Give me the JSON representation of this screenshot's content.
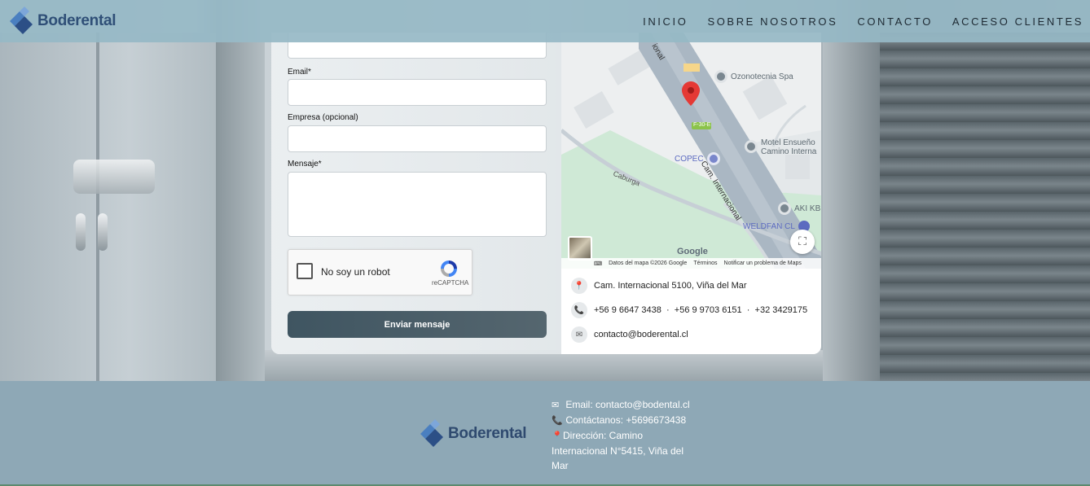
{
  "brand": {
    "name": "Boderental"
  },
  "nav": {
    "items": [
      {
        "label": "INICIO"
      },
      {
        "label": "SOBRE NOSOTROS"
      },
      {
        "label": "CONTACTO"
      },
      {
        "label": "ACCESO CLIENTES"
      }
    ]
  },
  "form": {
    "email_label": "Email*",
    "company_label": "Empresa (opcional)",
    "message_label": "Mensaje*",
    "recaptcha_label": "No soy un robot",
    "recaptcha_brand": "reCAPTCHA",
    "submit_label": "Enviar mensaje"
  },
  "map": {
    "places": {
      "ozonotecnia": "Ozonotecnia Spa",
      "motel_1": "Motel Ensueño",
      "motel_2": "Camino Interna",
      "copec": "COPEC",
      "aki": "AKI KB",
      "weldfan": "WELDFAN CL",
      "road_main": "Cam. Internacional",
      "road_top": "ional",
      "road_side": "Caburga",
      "route": "F-30-E"
    },
    "google": "Google",
    "attrib_data": "Datos del mapa ©2026 Google",
    "attrib_terms": "Términos",
    "attrib_report": "Notificar un problema de Maps"
  },
  "contact": {
    "address": "Cam. Internacional 5100, Viña del Mar",
    "phones": "+56 9 6647 3438  ·  +56 9 9703 6151  ·  +32 3429175",
    "email": "contacto@boderental.cl"
  },
  "footer": {
    "email": "Email: contacto@bodental.cl",
    "phone": "Contáctanos: +5696673438",
    "address": "Dirección: Camino Internacional N°5415, Viña del Mar"
  },
  "colors": {
    "brand": "#2f4f77",
    "navbar": "#96b8c5",
    "footer": "#8ea8b6",
    "button": "#3f5561",
    "pin": "#e53935"
  }
}
